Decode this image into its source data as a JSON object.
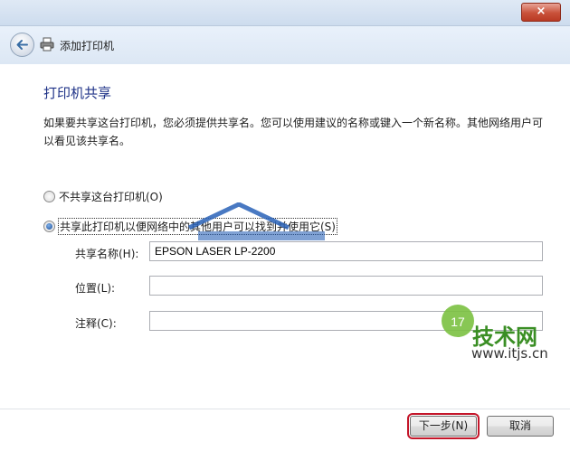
{
  "window": {
    "title": "添加打印机",
    "close_label": "×"
  },
  "page": {
    "heading": "打印机共享",
    "description": "如果要共享这台打印机，您必须提供共享名。您可以使用建议的名称或键入一个新名称。其他网络用户可以看见该共享名。"
  },
  "options": {
    "no_share_label": "不共享这台打印机(O)",
    "share_label": "共享此打印机以便网络中的其他用户可以找到并使用它(S)",
    "selected": "share"
  },
  "fields": {
    "share_name": {
      "label": "共享名称(H):",
      "value": "EPSON LASER LP-2200"
    },
    "location": {
      "label": "位置(L):",
      "value": ""
    },
    "comment": {
      "label": "注释(C):",
      "value": ""
    }
  },
  "buttons": {
    "next_label": "下一步(N)",
    "cancel_label": "取消"
  },
  "watermarks": {
    "site_text": "技术网",
    "site_badge": "17",
    "site_url": "www.itjs.cn"
  },
  "colors": {
    "heading": "#1e3287",
    "highlight": "#c4162a"
  }
}
